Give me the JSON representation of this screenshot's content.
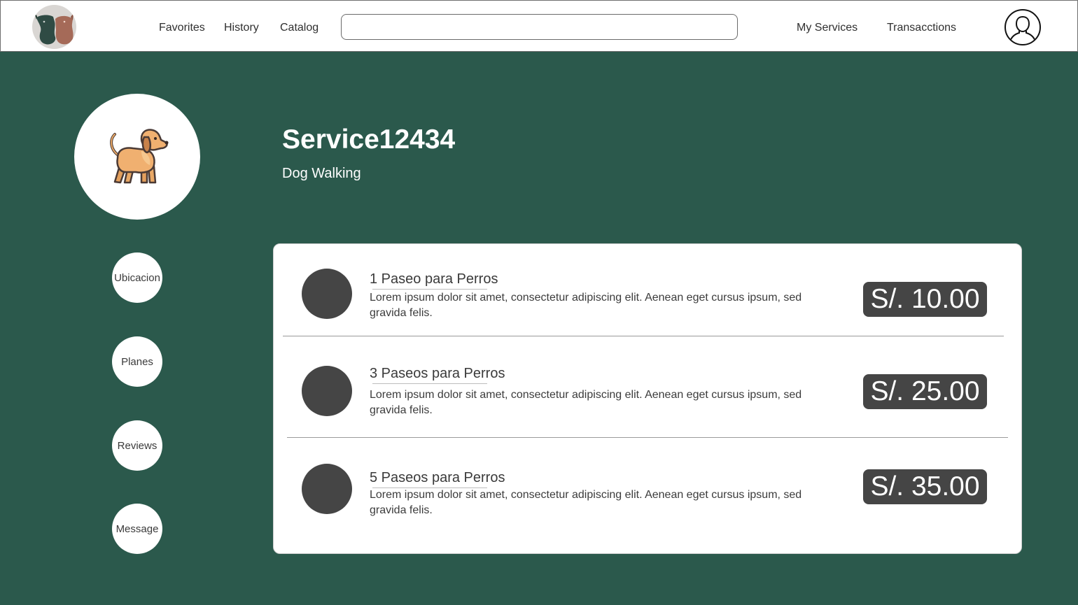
{
  "header": {
    "nav": {
      "favorites": "Favorites",
      "history": "History",
      "catalog": "Catalog",
      "my_services": "My Services",
      "transactions": "Transacctions"
    },
    "search": {
      "value": "",
      "placeholder": ""
    },
    "logo_icon": "dogs-logo-icon",
    "avatar_icon": "user-avatar-icon"
  },
  "service": {
    "title": "Service12434",
    "subtitle": "Dog Walking",
    "image_icon": "dog-icon"
  },
  "sidebar": {
    "buttons": [
      "Ubicacion",
      "Planes",
      "Reviews",
      "Message"
    ]
  },
  "plans": [
    {
      "name": "1 Paseo para Perros",
      "description": "Lorem ipsum dolor sit amet, consectetur adipiscing elit. Aenean eget cursus ipsum, sed gravida felis.",
      "price": "S/. 10.00"
    },
    {
      "name": "3 Paseos para Perros",
      "description": "Lorem ipsum dolor sit amet, consectetur adipiscing elit. Aenean eget cursus ipsum, sed gravida felis.",
      "price": "S/. 25.00"
    },
    {
      "name": "5 Paseos para Perros",
      "description": "Lorem ipsum dolor sit amet, consectetur adipiscing elit. Aenean eget cursus ipsum, sed gravida felis.",
      "price": "S/. 35.00"
    }
  ],
  "colors": {
    "background": "#2b594c",
    "card": "#ffffff",
    "dark_accent": "#454545"
  }
}
